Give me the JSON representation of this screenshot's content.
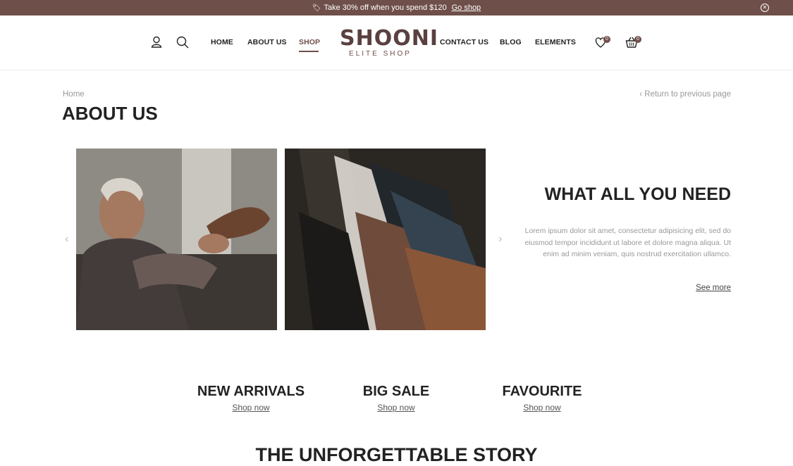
{
  "promo": {
    "text": "Take 30% off when you spend $120",
    "link": "Go shop"
  },
  "header": {
    "nav_left": [
      "HOME",
      "ABOUT US",
      "SHOP"
    ],
    "nav_right": [
      "CONTACT US",
      "BLOG",
      "ELEMENTS"
    ],
    "active_nav": "SHOP",
    "logo_main": "SHOONI",
    "logo_sub": "ELITE SHOP",
    "wishlist_count": "0",
    "cart_count": "0",
    "icons": [
      "user-icon",
      "search-icon",
      "heart-icon",
      "basket-icon"
    ]
  },
  "breadcrumb": "Home",
  "return_link": "Return to previous page",
  "page_title": "ABOUT US",
  "feature": {
    "title": "WHAT ALL YOU NEED",
    "text": "Lorem ipsum dolor sit amet, consectetur adipisicing elit, sed do eiusmod tempor incididunt ut labore et dolore magna aliqua. Ut enim ad minim veniam, quis nostrud exercitation ullamco.",
    "link": "See more"
  },
  "categories": [
    {
      "title": "NEW ARRIVALS",
      "link": "Shop now"
    },
    {
      "title": "BIG SALE",
      "link": "Shop now"
    },
    {
      "title": "FAVOURITE",
      "link": "Shop now"
    }
  ],
  "story_title": "THE UNFORGETTABLE STORY",
  "colors": {
    "brand": "#6f4f49",
    "text": "#222222",
    "muted": "#999999"
  }
}
